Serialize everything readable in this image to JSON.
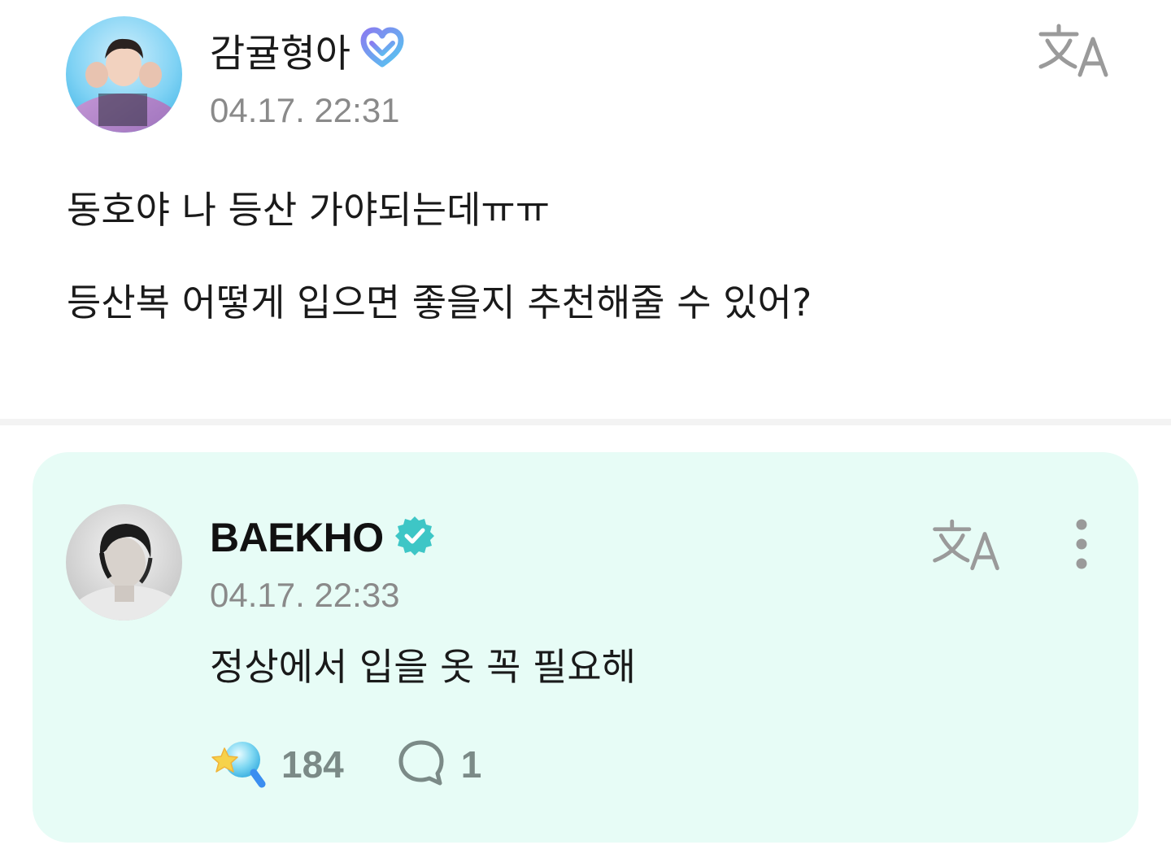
{
  "post": {
    "author": "감귤형아",
    "timestamp": "04.17. 22:31",
    "body_lines": [
      "동호야 나 등산 가야되는데ㅠㅠ",
      "등산복 어떻게 입으면 좋을지 추천해줄 수 있어?"
    ],
    "icons": {
      "avatar": "avatar",
      "badge": "membership-heart-icon",
      "translate": "translate-icon"
    }
  },
  "reply": {
    "author": "BAEKHO",
    "timestamp": "04.17. 22:33",
    "body": "정상에서 입을 옷 꼭 필요해",
    "likes": "184",
    "comments": "1",
    "icons": {
      "avatar": "avatar",
      "badge": "verified-check-icon",
      "translate": "translate-icon",
      "more": "more-vertical-icon",
      "like": "light-stick-icon",
      "comment": "comment-bubble-icon"
    }
  },
  "colors": {
    "reply_bg": "#e7fcf6",
    "verified": "#3ec6c6",
    "membership_heart_start": "#8a7cf0",
    "membership_heart_end": "#54c8f0",
    "muted_text": "#8a8a8a",
    "stat_text": "#7b8a87"
  }
}
